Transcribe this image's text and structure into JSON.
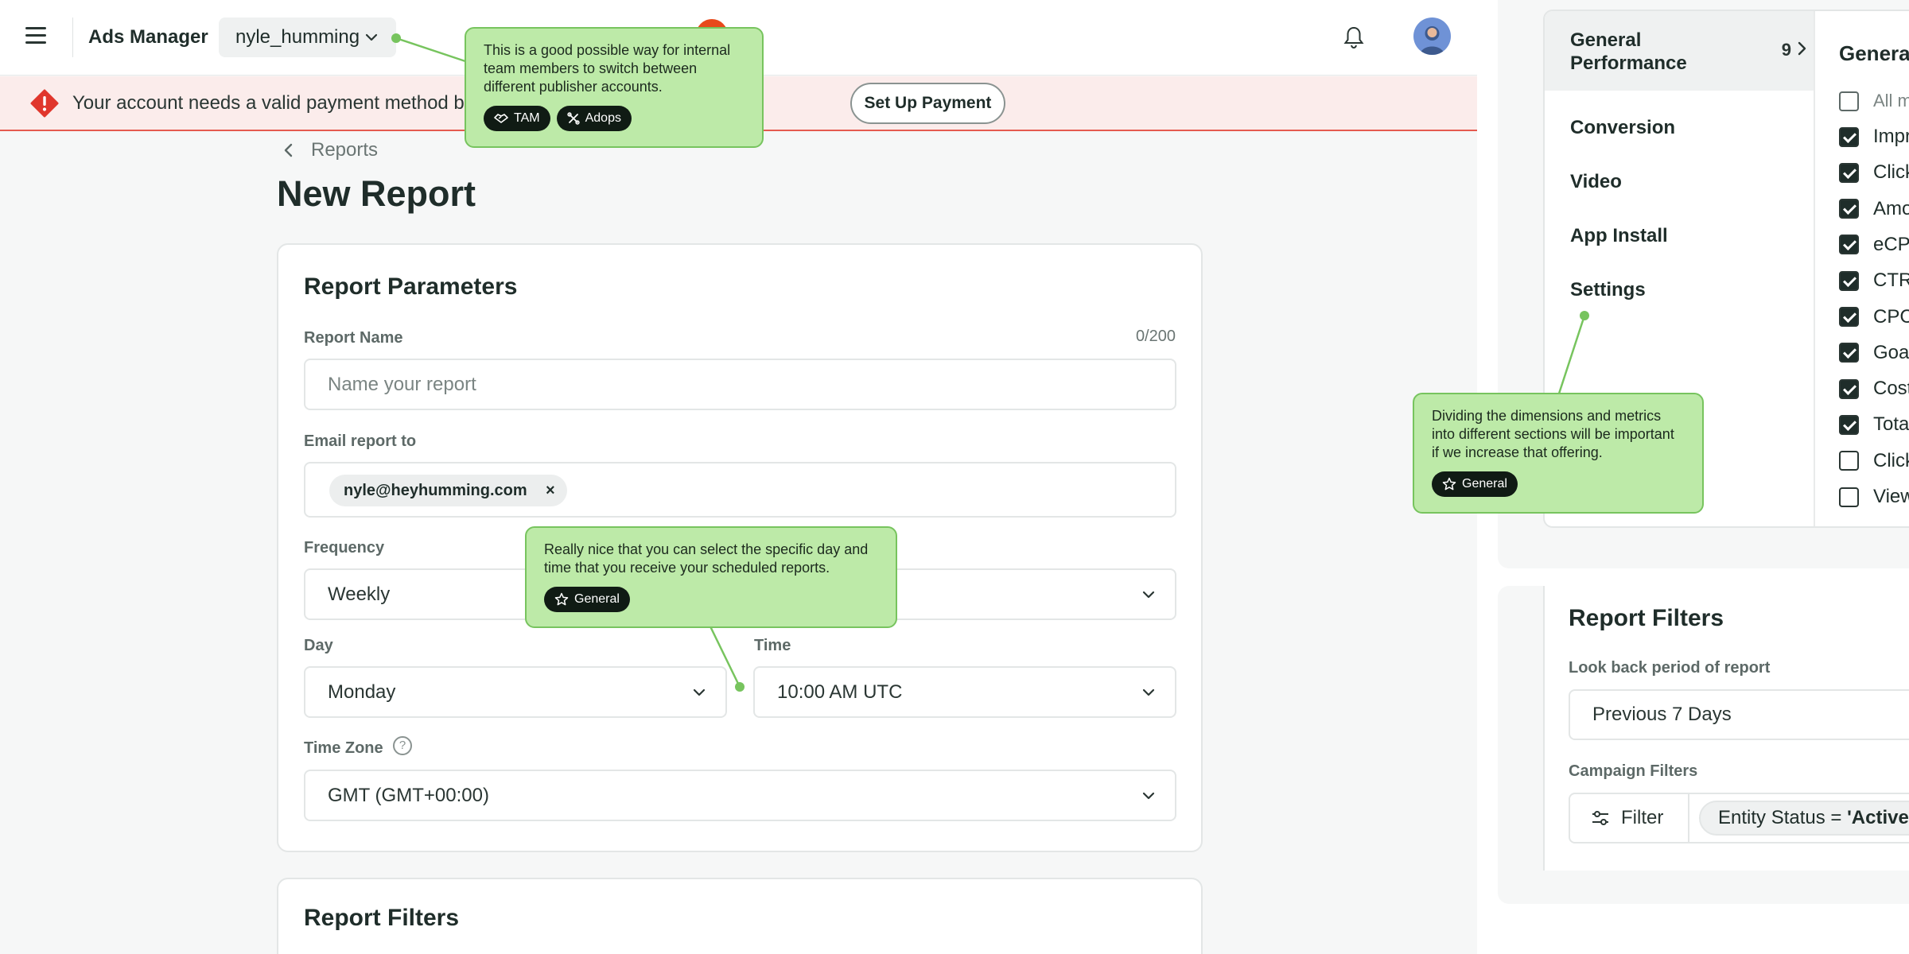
{
  "topbar": {
    "app_title": "Ads Manager",
    "account_switcher": {
      "label": "nyle_humming",
      "icon": "chevron-down-icon"
    },
    "notifications_icon": "bell-icon",
    "avatar_icon": "user-avatar"
  },
  "banner": {
    "text": "Your account needs a valid payment method before your ads can be delivered.",
    "button_label": "Set Up Payment",
    "icon": "alert-icon",
    "color": "#e0362c"
  },
  "breadcrumb": {
    "back_label": "Reports"
  },
  "page_title": "New Report",
  "report_parameters": {
    "title": "Report Parameters",
    "report_name": {
      "label": "Report Name",
      "placeholder": "Name your report",
      "value": "",
      "char_count": "0/200"
    },
    "email": {
      "label": "Email report to",
      "chips": [
        "nyle@heyhumming.com"
      ],
      "remove_glyph": "×"
    },
    "frequency": {
      "label": "Frequency",
      "value": "Weekly"
    },
    "day": {
      "label": "Day",
      "value": "Monday"
    },
    "time": {
      "label": "Time",
      "value": "10:00 AM UTC"
    },
    "time_zone": {
      "label": "Time Zone",
      "value": "GMT (GMT+00:00)",
      "help_glyph": "?"
    }
  },
  "report_filters_card": {
    "title": "Report Filters"
  },
  "metrics_panel": {
    "categories": [
      {
        "label": "General Performance",
        "count": "9",
        "active": true
      },
      {
        "label": "Conversion",
        "active": false
      },
      {
        "label": "Video",
        "active": false
      },
      {
        "label": "App Install",
        "active": false
      },
      {
        "label": "Settings",
        "active": false
      }
    ],
    "heading": "General Pe",
    "all_metrics_label": "All metr",
    "metrics": [
      {
        "label": "Impres",
        "checked": true
      },
      {
        "label": "Clicks",
        "checked": true
      },
      {
        "label": "Amoun",
        "checked": true
      },
      {
        "label": "eCPM",
        "checked": true
      },
      {
        "label": "CTR",
        "checked": true
      },
      {
        "label": "CPC",
        "checked": true
      },
      {
        "label": "Goal (A",
        "checked": true
      },
      {
        "label": "Cost Pe",
        "checked": true
      },
      {
        "label": "Total R",
        "checked": true
      },
      {
        "label": "Click T",
        "checked": false
      },
      {
        "label": "View T",
        "checked": false
      }
    ]
  },
  "report_filters_panel": {
    "title": "Report Filters",
    "lookback_label": "Look back period of report",
    "lookback_value": "Previous 7 Days",
    "campaign_label": "Campaign Filters",
    "filter_button": "Filter",
    "filter_chip_prefix": "Entity Status = ",
    "filter_chip_value": "'Active', 'I"
  },
  "comments": [
    {
      "text": "This is a good possible way for internal team members to switch between different publisher accounts.",
      "tags": [
        {
          "label": "TAM",
          "icon": "handshake-icon"
        },
        {
          "label": "Adops",
          "icon": "tools-icon"
        }
      ]
    },
    {
      "text": "Really nice that you can select the specific day and time that you receive your scheduled reports.",
      "tags": [
        {
          "label": "General",
          "icon": "star-icon"
        }
      ]
    },
    {
      "text": "Dividing the dimensions and metrics into different sections will be important if we increase that offering.",
      "tags": [
        {
          "label": "General",
          "icon": "star-icon"
        }
      ]
    }
  ],
  "colors": {
    "comment_fill": "#bdeaa8",
    "comment_border": "#77c45e",
    "text": "#1f2d2a",
    "banner_bg": "#fbeceb"
  }
}
